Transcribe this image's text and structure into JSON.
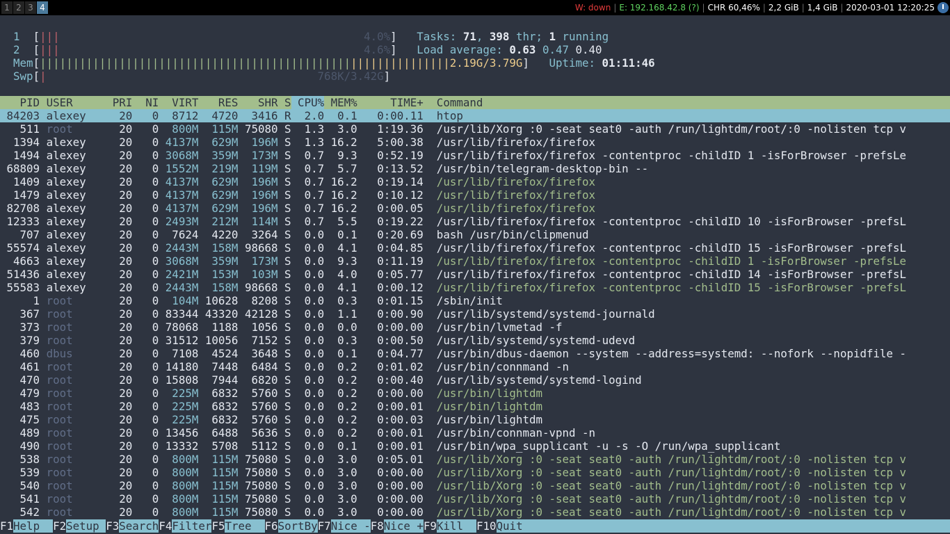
{
  "topbar": {
    "workspaces": [
      "1",
      "2",
      "3",
      "4"
    ],
    "active_workspace": "4",
    "wifi": "W: down",
    "ethernet": "E: 192.168.42.8 (?)",
    "battery": "CHR 60,46%",
    "disk1": "2,2 GiB",
    "disk2": "1,4 GiB",
    "clock": "2020-03-01 12:20:25",
    "power_icon": "power-icon"
  },
  "meters": {
    "cpu1": {
      "label": "1",
      "bars": "|||",
      "value": "4.0%"
    },
    "cpu2": {
      "label": "2",
      "bars": "|||",
      "value": "4.6%"
    },
    "mem": {
      "label": "Mem",
      "bars_green": "|||||||||||||||||||||||||||||||||||||||||||||||",
      "bars_yellow": "||||||||||||||||||",
      "value": "2.19G/3.79G"
    },
    "swp": {
      "label": "Swp",
      "bars": "|",
      "value": "768K/3.42G"
    }
  },
  "summary": {
    "tasks_label": "Tasks:",
    "tasks": "71",
    "threads": "398",
    "thr_label": "thr;",
    "running": "1",
    "running_label": "running",
    "load_label": "Load average:",
    "load1": "0.63",
    "load5": "0.47",
    "load15": "0.40",
    "uptime_label": "Uptime:",
    "uptime": "01:11:46"
  },
  "columns": [
    "PID",
    "USER",
    "PRI",
    "NI",
    "VIRT",
    "RES",
    "SHR",
    "S",
    "CPU%",
    "MEM%",
    "TIME+",
    "Command"
  ],
  "sorted_column": "CPU%",
  "processes": [
    {
      "pid": "84203",
      "user": "alexey",
      "pri": "20",
      "ni": "0",
      "virt": "8712",
      "res": "4720",
      "shr": "3416",
      "s": "R",
      "cpu": "2.0",
      "mem": "0.1",
      "time": "0:00.11",
      "cmd": "htop",
      "selected": true
    },
    {
      "pid": "511",
      "user": "root",
      "pri": "20",
      "ni": "0",
      "virt": "800M",
      "res": "115M",
      "shr": "75080",
      "s": "S",
      "cpu": "1.3",
      "mem": "3.0",
      "time": "1:19.36",
      "cmd": "/usr/lib/Xorg :0 -seat seat0 -auth /run/lightdm/root/:0 -nolisten tcp v"
    },
    {
      "pid": "1394",
      "user": "alexey",
      "pri": "20",
      "ni": "0",
      "virt": "4137M",
      "res": "629M",
      "shr": "196M",
      "s": "S",
      "cpu": "1.3",
      "mem": "16.2",
      "time": "5:00.38",
      "cmd": "/usr/lib/firefox/firefox"
    },
    {
      "pid": "1494",
      "user": "alexey",
      "pri": "20",
      "ni": "0",
      "virt": "3068M",
      "res": "359M",
      "shr": "173M",
      "s": "S",
      "cpu": "0.7",
      "mem": "9.3",
      "time": "0:52.19",
      "cmd": "/usr/lib/firefox/firefox -contentproc -childID 1 -isForBrowser -prefsLe"
    },
    {
      "pid": "68809",
      "user": "alexey",
      "pri": "20",
      "ni": "0",
      "virt": "1552M",
      "res": "219M",
      "shr": "119M",
      "s": "S",
      "cpu": "0.7",
      "mem": "5.7",
      "time": "0:13.52",
      "cmd": "/usr/bin/telegram-desktop-bin --"
    },
    {
      "pid": "1409",
      "user": "alexey",
      "pri": "20",
      "ni": "0",
      "virt": "4137M",
      "res": "629M",
      "shr": "196M",
      "s": "S",
      "cpu": "0.7",
      "mem": "16.2",
      "time": "0:19.14",
      "cmd": "/usr/lib/firefox/firefox",
      "thread": true
    },
    {
      "pid": "1479",
      "user": "alexey",
      "pri": "20",
      "ni": "0",
      "virt": "4137M",
      "res": "629M",
      "shr": "196M",
      "s": "S",
      "cpu": "0.7",
      "mem": "16.2",
      "time": "0:10.12",
      "cmd": "/usr/lib/firefox/firefox",
      "thread": true
    },
    {
      "pid": "82708",
      "user": "alexey",
      "pri": "20",
      "ni": "0",
      "virt": "4137M",
      "res": "629M",
      "shr": "196M",
      "s": "S",
      "cpu": "0.7",
      "mem": "16.2",
      "time": "0:00.05",
      "cmd": "/usr/lib/firefox/firefox",
      "thread": true
    },
    {
      "pid": "12333",
      "user": "alexey",
      "pri": "20",
      "ni": "0",
      "virt": "2493M",
      "res": "212M",
      "shr": "114M",
      "s": "S",
      "cpu": "0.7",
      "mem": "5.5",
      "time": "0:19.22",
      "cmd": "/usr/lib/firefox/firefox -contentproc -childID 10 -isForBrowser -prefsL"
    },
    {
      "pid": "707",
      "user": "alexey",
      "pri": "20",
      "ni": "0",
      "virt": "7624",
      "res": "4220",
      "shr": "3264",
      "s": "S",
      "cpu": "0.0",
      "mem": "0.1",
      "time": "0:20.69",
      "cmd": "bash /usr/bin/clipmenud"
    },
    {
      "pid": "55574",
      "user": "alexey",
      "pri": "20",
      "ni": "0",
      "virt": "2443M",
      "res": "158M",
      "shr": "98668",
      "s": "S",
      "cpu": "0.0",
      "mem": "4.1",
      "time": "0:04.85",
      "cmd": "/usr/lib/firefox/firefox -contentproc -childID 15 -isForBrowser -prefsL"
    },
    {
      "pid": "4663",
      "user": "alexey",
      "pri": "20",
      "ni": "0",
      "virt": "3068M",
      "res": "359M",
      "shr": "173M",
      "s": "S",
      "cpu": "0.0",
      "mem": "9.3",
      "time": "0:11.19",
      "cmd": "/usr/lib/firefox/firefox -contentproc -childID 1 -isForBrowser -prefsLe",
      "thread": true
    },
    {
      "pid": "51436",
      "user": "alexey",
      "pri": "20",
      "ni": "0",
      "virt": "2421M",
      "res": "153M",
      "shr": "103M",
      "s": "S",
      "cpu": "0.0",
      "mem": "4.0",
      "time": "0:05.77",
      "cmd": "/usr/lib/firefox/firefox -contentproc -childID 14 -isForBrowser -prefsL"
    },
    {
      "pid": "55583",
      "user": "alexey",
      "pri": "20",
      "ni": "0",
      "virt": "2443M",
      "res": "158M",
      "shr": "98668",
      "s": "S",
      "cpu": "0.0",
      "mem": "4.1",
      "time": "0:00.12",
      "cmd": "/usr/lib/firefox/firefox -contentproc -childID 15 -isForBrowser -prefsL",
      "thread": true
    },
    {
      "pid": "1",
      "user": "root",
      "pri": "20",
      "ni": "0",
      "virt": "104M",
      "res": "10628",
      "shr": "8208",
      "s": "S",
      "cpu": "0.0",
      "mem": "0.3",
      "time": "0:01.15",
      "cmd": "/sbin/init"
    },
    {
      "pid": "367",
      "user": "root",
      "pri": "20",
      "ni": "0",
      "virt": "83344",
      "res": "43320",
      "shr": "42128",
      "s": "S",
      "cpu": "0.0",
      "mem": "1.1",
      "time": "0:00.90",
      "cmd": "/usr/lib/systemd/systemd-journald"
    },
    {
      "pid": "373",
      "user": "root",
      "pri": "20",
      "ni": "0",
      "virt": "78068",
      "res": "1188",
      "shr": "1056",
      "s": "S",
      "cpu": "0.0",
      "mem": "0.0",
      "time": "0:00.00",
      "cmd": "/usr/bin/lvmetad -f"
    },
    {
      "pid": "379",
      "user": "root",
      "pri": "20",
      "ni": "0",
      "virt": "31512",
      "res": "10056",
      "shr": "7152",
      "s": "S",
      "cpu": "0.0",
      "mem": "0.3",
      "time": "0:00.50",
      "cmd": "/usr/lib/systemd/systemd-udevd"
    },
    {
      "pid": "460",
      "user": "dbus",
      "pri": "20",
      "ni": "0",
      "virt": "7108",
      "res": "4524",
      "shr": "3648",
      "s": "S",
      "cpu": "0.0",
      "mem": "0.1",
      "time": "0:04.77",
      "cmd": "/usr/bin/dbus-daemon --system --address=systemd: --nofork --nopidfile -"
    },
    {
      "pid": "461",
      "user": "root",
      "pri": "20",
      "ni": "0",
      "virt": "14180",
      "res": "7448",
      "shr": "6484",
      "s": "S",
      "cpu": "0.0",
      "mem": "0.2",
      "time": "0:01.02",
      "cmd": "/usr/bin/connmand -n"
    },
    {
      "pid": "470",
      "user": "root",
      "pri": "20",
      "ni": "0",
      "virt": "15808",
      "res": "7944",
      "shr": "6820",
      "s": "S",
      "cpu": "0.0",
      "mem": "0.2",
      "time": "0:00.40",
      "cmd": "/usr/lib/systemd/systemd-logind"
    },
    {
      "pid": "479",
      "user": "root",
      "pri": "20",
      "ni": "0",
      "virt": "225M",
      "res": "6832",
      "shr": "5760",
      "s": "S",
      "cpu": "0.0",
      "mem": "0.2",
      "time": "0:00.00",
      "cmd": "/usr/bin/lightdm",
      "thread": true
    },
    {
      "pid": "483",
      "user": "root",
      "pri": "20",
      "ni": "0",
      "virt": "225M",
      "res": "6832",
      "shr": "5760",
      "s": "S",
      "cpu": "0.0",
      "mem": "0.2",
      "time": "0:00.01",
      "cmd": "/usr/bin/lightdm",
      "thread": true
    },
    {
      "pid": "475",
      "user": "root",
      "pri": "20",
      "ni": "0",
      "virt": "225M",
      "res": "6832",
      "shr": "5760",
      "s": "S",
      "cpu": "0.0",
      "mem": "0.2",
      "time": "0:00.03",
      "cmd": "/usr/bin/lightdm"
    },
    {
      "pid": "489",
      "user": "root",
      "pri": "20",
      "ni": "0",
      "virt": "13456",
      "res": "6488",
      "shr": "5636",
      "s": "S",
      "cpu": "0.0",
      "mem": "0.2",
      "time": "0:00.01",
      "cmd": "/usr/bin/connman-vpnd -n"
    },
    {
      "pid": "490",
      "user": "root",
      "pri": "20",
      "ni": "0",
      "virt": "13332",
      "res": "5708",
      "shr": "5112",
      "s": "S",
      "cpu": "0.0",
      "mem": "0.1",
      "time": "0:00.01",
      "cmd": "/usr/bin/wpa_supplicant -u -s -O /run/wpa_supplicant"
    },
    {
      "pid": "538",
      "user": "root",
      "pri": "20",
      "ni": "0",
      "virt": "800M",
      "res": "115M",
      "shr": "75080",
      "s": "S",
      "cpu": "0.0",
      "mem": "3.0",
      "time": "0:05.01",
      "cmd": "/usr/lib/Xorg :0 -seat seat0 -auth /run/lightdm/root/:0 -nolisten tcp v",
      "thread": true
    },
    {
      "pid": "539",
      "user": "root",
      "pri": "20",
      "ni": "0",
      "virt": "800M",
      "res": "115M",
      "shr": "75080",
      "s": "S",
      "cpu": "0.0",
      "mem": "3.0",
      "time": "0:00.00",
      "cmd": "/usr/lib/Xorg :0 -seat seat0 -auth /run/lightdm/root/:0 -nolisten tcp v",
      "thread": true
    },
    {
      "pid": "540",
      "user": "root",
      "pri": "20",
      "ni": "0",
      "virt": "800M",
      "res": "115M",
      "shr": "75080",
      "s": "S",
      "cpu": "0.0",
      "mem": "3.0",
      "time": "0:00.00",
      "cmd": "/usr/lib/Xorg :0 -seat seat0 -auth /run/lightdm/root/:0 -nolisten tcp v",
      "thread": true
    },
    {
      "pid": "541",
      "user": "root",
      "pri": "20",
      "ni": "0",
      "virt": "800M",
      "res": "115M",
      "shr": "75080",
      "s": "S",
      "cpu": "0.0",
      "mem": "3.0",
      "time": "0:00.00",
      "cmd": "/usr/lib/Xorg :0 -seat seat0 -auth /run/lightdm/root/:0 -nolisten tcp v",
      "thread": true
    },
    {
      "pid": "542",
      "user": "root",
      "pri": "20",
      "ni": "0",
      "virt": "800M",
      "res": "115M",
      "shr": "75080",
      "s": "S",
      "cpu": "0.0",
      "mem": "3.0",
      "time": "0:00.00",
      "cmd": "/usr/lib/Xorg :0 -seat seat0 -auth /run/lightdm/root/:0 -nolisten tcp v",
      "thread": true
    }
  ],
  "function_keys": [
    {
      "key": "F1",
      "label": "Help  "
    },
    {
      "key": "F2",
      "label": "Setup "
    },
    {
      "key": "F3",
      "label": "Search"
    },
    {
      "key": "F4",
      "label": "Filter"
    },
    {
      "key": "F5",
      "label": "Tree  "
    },
    {
      "key": "F6",
      "label": "SortBy"
    },
    {
      "key": "F7",
      "label": "Nice -"
    },
    {
      "key": "F8",
      "label": "Nice +"
    },
    {
      "key": "F9",
      "label": "Kill  "
    },
    {
      "key": "F10",
      "label": "Quit  "
    }
  ],
  "colors": {
    "background": "#2e3440",
    "header": "#a3be8c",
    "selection": "#88c0d0",
    "thread_text": "#a3be8c"
  }
}
